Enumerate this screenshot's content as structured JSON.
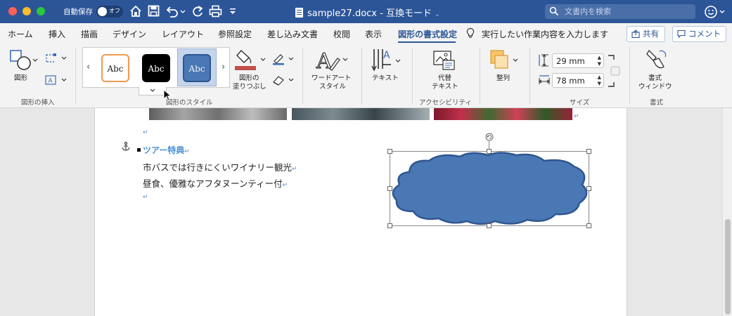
{
  "titlebar": {
    "autosave_label": "自動保存",
    "autosave_state": "オフ",
    "document_title": "sample27.docx  -  互換モード",
    "search_placeholder": "文書内を検索"
  },
  "tabs": [
    {
      "label": "ホーム",
      "active": false
    },
    {
      "label": "挿入",
      "active": false
    },
    {
      "label": "描画",
      "active": false
    },
    {
      "label": "デザイン",
      "active": false
    },
    {
      "label": "レイアウト",
      "active": false
    },
    {
      "label": "参照設定",
      "active": false
    },
    {
      "label": "差し込み文書",
      "active": false
    },
    {
      "label": "校閲",
      "active": false
    },
    {
      "label": "表示",
      "active": false
    },
    {
      "label": "図形の書式設定",
      "active": true
    }
  ],
  "tell_me": "実行したい作業内容を入力します",
  "header_buttons": {
    "share": "共有",
    "comment": "コメント"
  },
  "ribbon": {
    "insert_shapes": {
      "shape_label": "図形",
      "group_label": "図形の挿入"
    },
    "shape_styles": {
      "gallery": [
        "Abc",
        "Abc",
        "Abc"
      ],
      "fill_label_1": "図形の",
      "fill_label_2": "塗りつぶし",
      "group_label": "図形のスタイル"
    },
    "wordart": {
      "label_1": "ワードアート",
      "label_2": "スタイル"
    },
    "text": {
      "label": "テキスト"
    },
    "accessibility": {
      "label_1": "代替",
      "label_2": "テキスト",
      "group_label": "アクセシビリティ"
    },
    "arrange": {
      "label": "整列"
    },
    "size": {
      "height": "29 mm",
      "width": "78 mm",
      "group_label": "サイズ"
    },
    "format": {
      "label_1": "書式",
      "label_2": "ウィンドウ",
      "group_label": "書式"
    }
  },
  "document": {
    "heading": "ツアー特典",
    "line1": "市バスでは行きにくいワイナリー観光",
    "line2": "昼食、優雅なアフタヌーンティー付",
    "paragraph_mark": "↵"
  },
  "colors": {
    "titlebar": "#2c5598",
    "accent": "#2b5797",
    "cloud_fill": "#4a78b5",
    "cloud_stroke": "#2f5690",
    "heading_text": "#4b8fd6"
  }
}
